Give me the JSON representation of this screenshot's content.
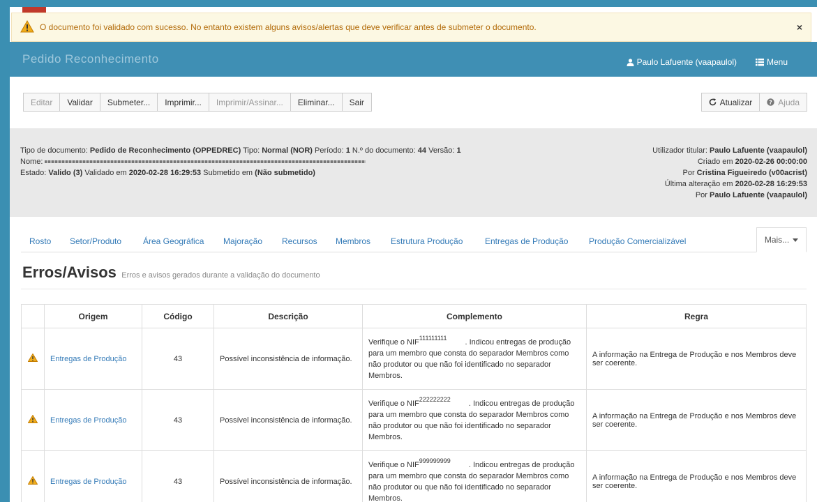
{
  "alert": {
    "message": "O documento foi validado com sucesso. No entanto existem alguns avisos/alertas que deve verificar antes de submeter o documento.",
    "close": "×",
    "icon": "warning-icon",
    "color": "#b26a08"
  },
  "navbar": {
    "title": "Pedido Reconhecimento",
    "user": "Paulo Lafuente (vaapaulol)",
    "menu": "Menu",
    "color": "#3f8fb4"
  },
  "toolbar": {
    "buttons": [
      "Editar",
      "Validar",
      "Submeter...",
      "Imprimir...",
      "Imprimir/Assinar...",
      "Eliminar...",
      "Sair"
    ],
    "refresh": "Atualizar",
    "help": "Ajuda"
  },
  "doc": {
    "tipo_label": "Tipo de documento:",
    "tipo": "Pedido de Reconhecimento (OPPEDREC)",
    "tipo2_label": "Tipo:",
    "tipo2": "Normal (NOR)",
    "periodo_label": "Período:",
    "periodo": "1",
    "numero_label": "N.º do documento:",
    "numero": "44",
    "versao_label": "Versão:",
    "versao": "1",
    "nome_label": "Nome:",
    "estado_label": "Estado:",
    "estado": "Valido (3)",
    "validado_label": "Validado em",
    "validado": "2020-02-28 16:29:53",
    "submetido_label": "Submetido em",
    "submetido": "(Não submetido)",
    "titular_label": "Utilizador titular:",
    "titular": "Paulo Lafuente (vaapaulol)",
    "criado_label": "Criado em",
    "criado": "2020-02-26 00:00:00",
    "por_label": "Por",
    "criado_por": "Cristina Figueiredo (v00acrist)",
    "alteracao_label": "Última alteração em",
    "alteracao": "2020-02-28 16:29:53",
    "alterado_por": "Paulo Lafuente (vaapaulol)"
  },
  "tabs": [
    "Rosto",
    "Setor/Produto",
    "Área Geográfica",
    "Majoração",
    "Recursos",
    "Membros",
    "Estrutura Produção",
    "Entregas de Produção",
    "Produção Comercializável"
  ],
  "tab_more": "Mais...",
  "section": {
    "title": "Erros/Avisos",
    "subtitle": "Erros e avisos gerados durante a validação do documento"
  },
  "table": {
    "headers": [
      "Origem",
      "Código",
      "Descrição",
      "Complemento",
      "Regra"
    ],
    "rows": [
      {
        "origem": "Entregas de Produção",
        "codigo": "43",
        "descricao": "Possível inconsistência de informação.",
        "comp_pre": "Verifique o NIF",
        "nif": "111111111",
        "comp_post": ". Indicou entregas de produção para um membro que consta do separador Membros como não produtor ou que não foi identificado no separador Membros.",
        "regra": "A informação na Entrega de Produção e nos Membros deve ser coerente."
      },
      {
        "origem": "Entregas de Produção",
        "codigo": "43",
        "descricao": "Possível inconsistência de informação.",
        "comp_pre": "Verifique o NIF",
        "nif": "222222222",
        "comp_post": ". Indicou entregas de produção para um membro que consta do separador Membros como não produtor ou que não foi identificado no separador Membros.",
        "regra": "A informação na Entrega de Produção e nos Membros deve ser coerente."
      },
      {
        "origem": "Entregas de Produção",
        "codigo": "43",
        "descricao": "Possível inconsistência de informação.",
        "comp_pre": "Verifique o NIF",
        "nif": "999999999",
        "comp_post": ". Indicou entregas de produção para um membro que consta do separador Membros como não produtor ou que não foi identificado no separador Membros.",
        "regra": "A informação na Entrega de Produção e nos Membros deve ser coerente."
      }
    ]
  }
}
